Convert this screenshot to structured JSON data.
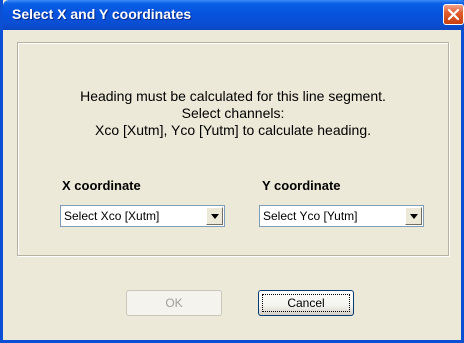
{
  "window": {
    "title": "Select X and Y coordinates",
    "close_icon": "close-icon"
  },
  "message": {
    "line1": "Heading must be calculated for this line segment.",
    "line2": "Select channels:",
    "line3": "Xco [Xutm], Yco [Yutm] to calculate heading."
  },
  "x_coordinate": {
    "label": "X coordinate",
    "selected": "Select Xco [Xutm]"
  },
  "y_coordinate": {
    "label": "Y coordinate",
    "selected": "Select Yco [Yutm]"
  },
  "buttons": {
    "ok_label": "OK",
    "ok_enabled": false,
    "cancel_label": "Cancel"
  },
  "colors": {
    "title_bar": "#0a4fd4",
    "dialog_bg": "#ece9d8",
    "close_button": "#e25c2f"
  }
}
